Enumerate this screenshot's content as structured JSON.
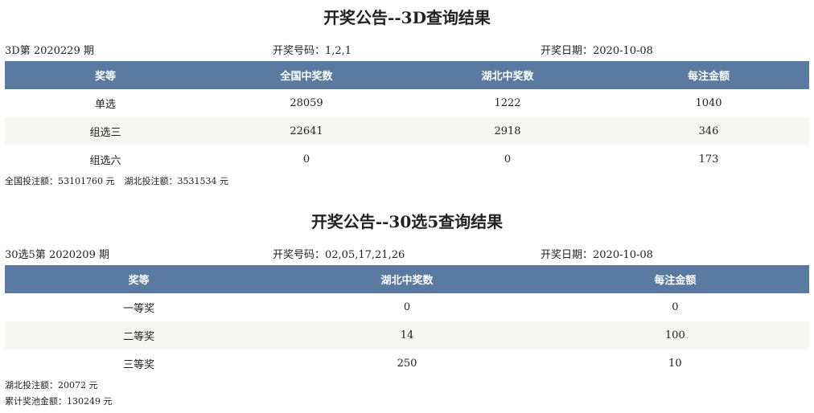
{
  "section1": {
    "title": "开奖公告--3D查询结果",
    "issue": "3D第 2020229 期",
    "numbers": "开奖号码：1,2,1",
    "date": "开奖日期：2020-10-08",
    "headers": [
      "奖等",
      "全国中奖数",
      "湖北中奖数",
      "每注金额"
    ],
    "rows": [
      [
        "单选",
        "28059",
        "1222",
        "1040"
      ],
      [
        "组选三",
        "22641",
        "2918",
        "346"
      ],
      [
        "组选六",
        "0",
        "0",
        "173"
      ]
    ],
    "national_bet": "全国投注额：53101760 元",
    "hubei_bet": "湖北投注额：3531534 元"
  },
  "section2": {
    "title": "开奖公告--30选5查询结果",
    "issue": "30选5第 2020209 期",
    "numbers": "开奖号码：02,05,17,21,26",
    "date": "开奖日期：2020-10-08",
    "headers": [
      "奖等",
      "湖北中奖数",
      "每注金额"
    ],
    "rows": [
      [
        "一等奖",
        "0",
        "0"
      ],
      [
        "二等奖",
        "14",
        "100"
      ],
      [
        "三等奖",
        "250",
        "10"
      ]
    ],
    "hubei_bet": "湖北投注额：20072 元",
    "pool": "累计奖池金额：130249 元"
  }
}
